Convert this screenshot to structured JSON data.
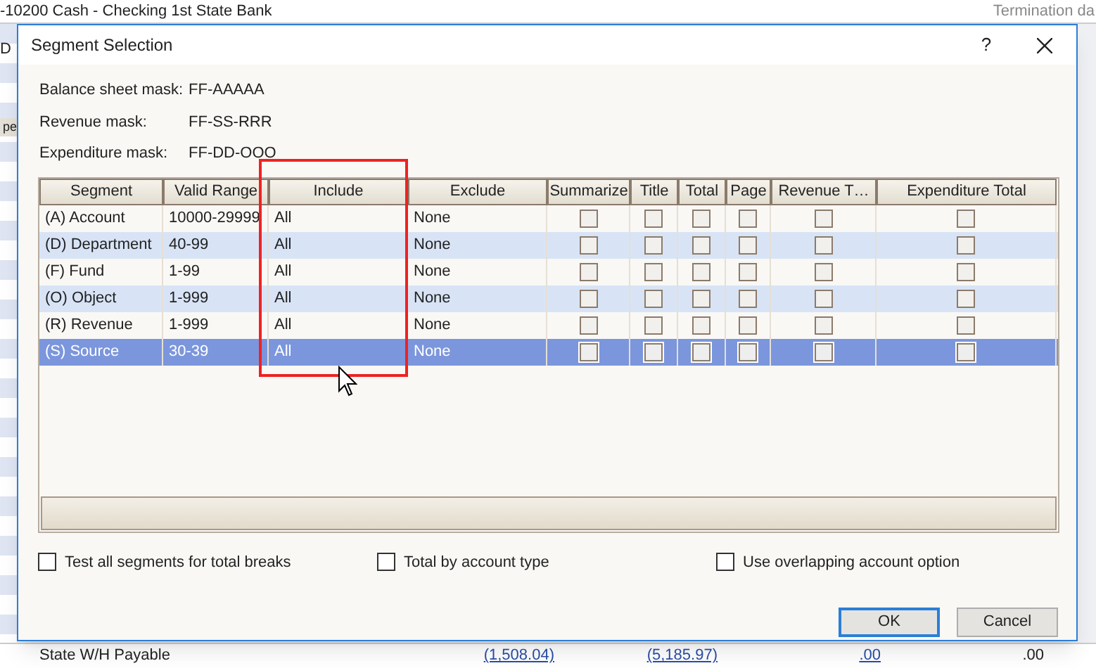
{
  "background": {
    "header_account": "-10200  Cash - Checking 1st State Bank",
    "header_right": "Termination da",
    "left_tab": "D",
    "left_button": "pe",
    "bottom_row": [
      "State W/H Payable",
      "(1,508.04)",
      "(5,185.97)",
      ".00",
      ".00"
    ]
  },
  "dialog": {
    "title": "Segment Selection",
    "help": "?",
    "masks": [
      {
        "label": "Balance sheet mask:",
        "value": "FF-AAAAA"
      },
      {
        "label": "Revenue mask:",
        "value": "FF-SS-RRR"
      },
      {
        "label": "Expenditure mask:",
        "value": "FF-DD-OOO"
      }
    ],
    "table": {
      "columns": [
        "Segment",
        "Valid Range",
        "Include",
        "Exclude",
        "Summarize",
        "Title",
        "Total",
        "Page",
        "Revenue T…",
        "Expenditure Total"
      ],
      "rows": [
        {
          "segment": "(A) Account",
          "valid_range": "10000-29999",
          "include": "All",
          "exclude": "None",
          "checks": [
            false,
            false,
            false,
            false,
            false,
            false
          ],
          "selected": false
        },
        {
          "segment": "(D) Department",
          "valid_range": "40-99",
          "include": "All",
          "exclude": "None",
          "checks": [
            false,
            false,
            false,
            false,
            false,
            false
          ],
          "selected": false
        },
        {
          "segment": "(F) Fund",
          "valid_range": "1-99",
          "include": "All",
          "exclude": "None",
          "checks": [
            false,
            false,
            false,
            false,
            false,
            false
          ],
          "selected": false
        },
        {
          "segment": "(O) Object",
          "valid_range": "1-999",
          "include": "All",
          "exclude": "None",
          "checks": [
            false,
            false,
            false,
            false,
            false,
            false
          ],
          "selected": false
        },
        {
          "segment": "(R) Revenue",
          "valid_range": "1-999",
          "include": "All",
          "exclude": "None",
          "checks": [
            false,
            false,
            false,
            false,
            false,
            false
          ],
          "selected": false
        },
        {
          "segment": "(S) Source",
          "valid_range": "30-39",
          "include": "All",
          "exclude": "None",
          "checks": [
            false,
            false,
            false,
            false,
            false,
            false
          ],
          "selected": true
        }
      ]
    },
    "options": [
      {
        "label": "Test all segments for total breaks",
        "checked": false
      },
      {
        "label": "Total by account type",
        "checked": false
      },
      {
        "label": "Use overlapping account option",
        "checked": false
      }
    ],
    "buttons": [
      {
        "label": "OK",
        "default": true
      },
      {
        "label": "Cancel",
        "default": false
      }
    ]
  }
}
